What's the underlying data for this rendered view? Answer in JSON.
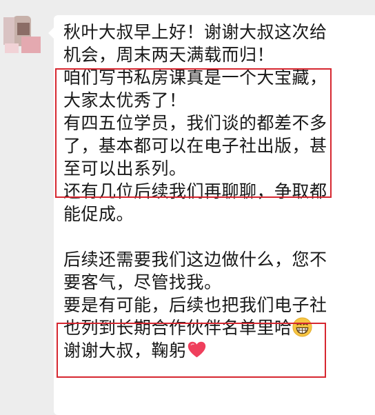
{
  "message": {
    "lines": [
      "秋叶大叔早上好！谢谢大叔这次给",
      "机会，周末两天满载而归！",
      "咱们写书私房课真是一个大宝藏，",
      "大家太优秀了！",
      "有四五位学员，我们谈的都差不多",
      "了，基本都可以在电子社出版，甚",
      "至可以出系列。",
      "还有几位后续我们再聊聊，争取都",
      "能促成。",
      "",
      "后续还需要我们这边做什么，您不",
      "要客气，尽管找我。",
      "要是有可能，后续也把我们电子社",
      "也列到长期合作伙伴名单里哈",
      "谢谢大叔，鞠躬"
    ],
    "icons": [
      "grin-emoji-icon",
      "heart-icon"
    ],
    "colors": {
      "highlight_box": "#d6262f",
      "bubble_bg": "#ffffff",
      "page_bg": "#ededed",
      "heart": "#ef3f5c",
      "emoji": "#f6c543"
    }
  }
}
